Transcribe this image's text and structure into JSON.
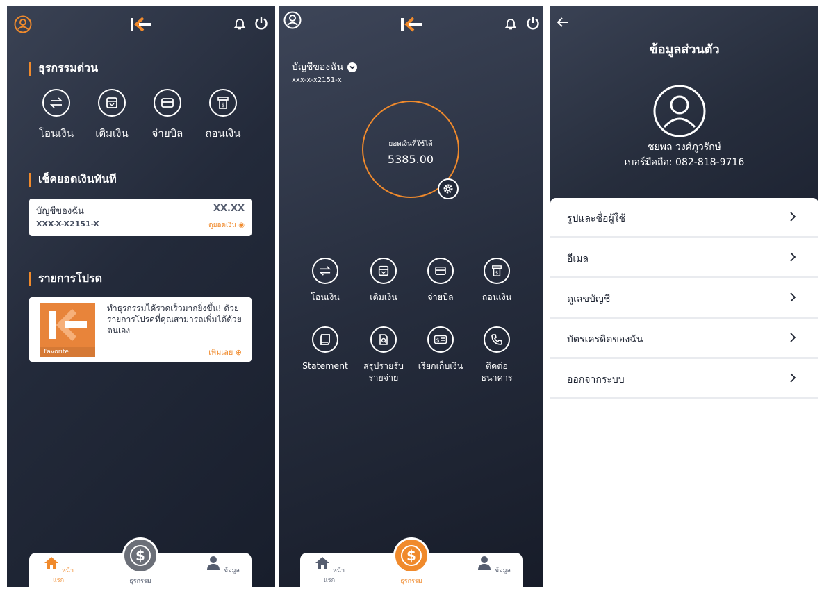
{
  "colors": {
    "accent": "#f08a2c",
    "dark_bg": "#232a3a",
    "text_dark": "#1f2533"
  },
  "screen1": {
    "quick_title": "ธุรกรรมด่วน",
    "quick_items": [
      {
        "label": "โอนเงิน",
        "icon": "transfer-icon"
      },
      {
        "label": "เติมเงิน",
        "icon": "topup-icon"
      },
      {
        "label": "จ่ายบิล",
        "icon": "card-icon"
      },
      {
        "label": "ถอนเงิน",
        "icon": "withdraw-icon"
      }
    ],
    "balance_title": "เช็คยอดเงินทันที",
    "balance_card": {
      "name": "บัญชีของฉัน",
      "number": "XXX-X-X2151-X",
      "amount": "XX.XX",
      "show_label": "ดูยอดเงิน ◉"
    },
    "fav_title": "รายการโปรด",
    "fav_card": {
      "logo_text": "Favorite",
      "text": "ทำธุรกรรมได้รวดเร็วมากยิ่งขึ้น! ด้วยรายการโปรดที่คุณสามารถเพิ่มได้ด้วยตนเอง",
      "add_label": "เพิ่มเลย ⊕"
    },
    "nav": {
      "home": "หน้าแรก",
      "transactions": "ธุรกรรม",
      "info": "ข้อมูล"
    }
  },
  "screen2": {
    "account_title": "บัญชีของฉัน",
    "account_number": "xxx-x-x2151-x",
    "balance_label": "ยอดเงินที่ใช้ได้",
    "balance_value": "5385.00",
    "grid": [
      {
        "label": "โอนเงิน",
        "icon": "transfer-icon"
      },
      {
        "label": "เติมเงิน",
        "icon": "topup-icon"
      },
      {
        "label": "จ่ายบิล",
        "icon": "card-icon"
      },
      {
        "label": "ถอนเงิน",
        "icon": "withdraw-icon"
      },
      {
        "label": "Statement",
        "icon": "statement-icon"
      },
      {
        "label": "สรุปรายรับ\nรายจ่าย",
        "icon": "summary-icon"
      },
      {
        "label": "เรียกเก็บเงิน",
        "icon": "bill-request-icon"
      },
      {
        "label": "ติดต่อ\nธนาคาร",
        "icon": "phone-icon"
      }
    ],
    "nav": {
      "home": "หน้าแรก",
      "transactions": "ธุรกรรม",
      "info": "ข้อมูล"
    }
  },
  "screen3": {
    "title": "ข้อมูลส่วนตัว",
    "name": "ชยพล วงศ์ภูวรักษ์",
    "phone": "เบอร์มือถือ: 082-818-9716",
    "menu": [
      {
        "label": "รูปและชื่อผู้ใช้"
      },
      {
        "label": "อีเมล"
      },
      {
        "label": "ดูเลขบัญชี"
      },
      {
        "label": "บัตรเครดิตของฉัน"
      },
      {
        "label": "ออกจากระบบ"
      }
    ]
  }
}
